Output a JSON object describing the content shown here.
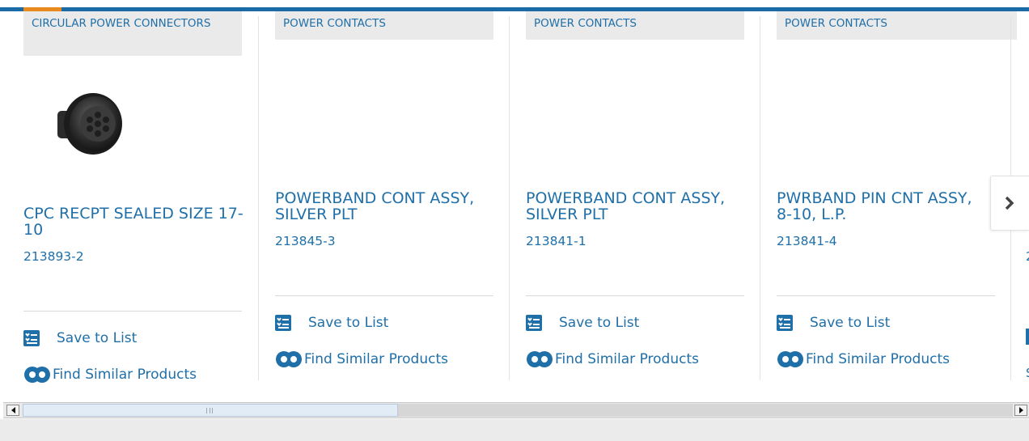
{
  "products": [
    {
      "category": "CIRCULAR POWER CONNECTORS",
      "title": "CPC RECPT SEALED SIZE 17-10",
      "part_number": "213893-2",
      "has_image": true,
      "save_label": "Save to List",
      "similar_label": "Find Similar Products"
    },
    {
      "category": "POWER CONTACTS",
      "title": "POWERBAND CONT ASSY, SILVER PLT",
      "part_number": "213845-3",
      "has_image": false,
      "save_label": "Save to List",
      "similar_label": "Find Similar Products"
    },
    {
      "category": "POWER CONTACTS",
      "title": "POWERBAND CONT ASSY, SILVER PLT",
      "part_number": "213841-1",
      "has_image": false,
      "save_label": "Save to List",
      "similar_label": "Find Similar Products"
    },
    {
      "category": "POWER CONTACTS",
      "title": "PWRBAND PIN CNT ASSY, 8-10, L.P.",
      "part_number": "213841-4",
      "has_image": false,
      "save_label": "Save to List",
      "similar_label": "Find Similar Products"
    }
  ],
  "peek": {
    "part_char": "2",
    "similar_char": "S"
  },
  "carousel": {
    "next_icon": "chevron-right-icon"
  },
  "colors": {
    "brand_blue": "#1f6fa8",
    "accent_orange": "#e98a1f",
    "top_bar": "#1a6aa8"
  }
}
